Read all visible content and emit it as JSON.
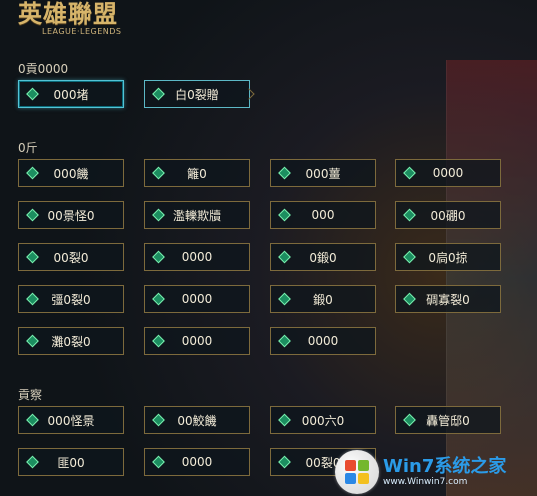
{
  "logo": {
    "title": "英雄聯盟",
    "subtitle": "LEAGUE·LEGENDS"
  },
  "sections": [
    {
      "title": "0貢0000",
      "top": 0
    },
    {
      "title": "0斤",
      "top": 0
    },
    {
      "title": "貢察",
      "top": 0
    }
  ],
  "buttons": {
    "row1": [
      "000堵",
      "白0裂贈"
    ],
    "grid": [
      [
        "000饑",
        "籬0",
        "000薑",
        "0000"
      ],
      [
        "00景怪0",
        "濫轢欺牘",
        "000",
        "00硼0"
      ],
      [
        "00裂0",
        "0000",
        "0鍛0",
        "0扃0掠"
      ],
      [
        "彊0裂0",
        "0000",
        "鍛0",
        "碉寡裂0"
      ],
      [
        "灘0裂0",
        "0000",
        "0000"
      ]
    ],
    "bottom": [
      [
        "000怪景",
        "00鮫饑",
        "000六0",
        "轟管邸0"
      ],
      [
        "匪00",
        "0000",
        "00裂0"
      ]
    ]
  },
  "watermark": {
    "main": "Win7系统之家",
    "sub": "www.Winwin7.com"
  }
}
